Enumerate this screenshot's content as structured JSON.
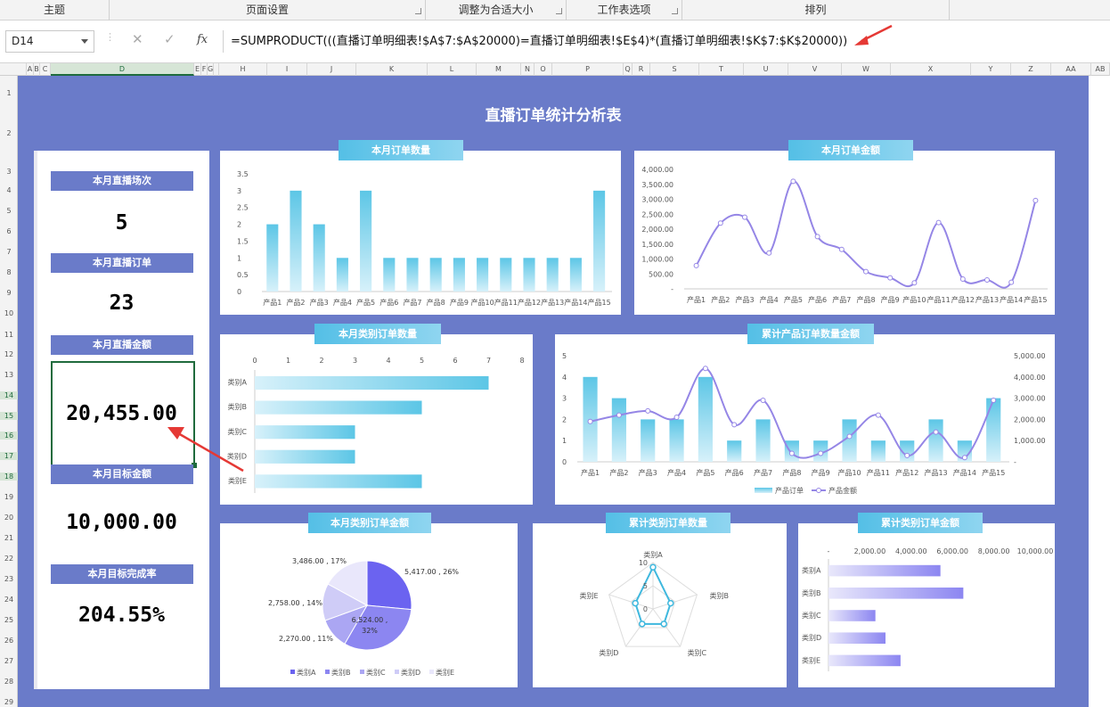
{
  "ribbon": {
    "groups": [
      {
        "label": "主题"
      },
      {
        "label": "页面设置"
      },
      {
        "label": "调整为合适大小"
      },
      {
        "label": "工作表选项"
      },
      {
        "label": "排列"
      }
    ]
  },
  "formula_bar": {
    "name_box": "D14",
    "cancel": "✕",
    "enter": "✓",
    "fx": "fx",
    "formula": "=SUMPRODUCT(((直播订单明细表!$A$7:$A$20000)=直播订单明细表!$E$4)*(直播订单明细表!$K$7:$K$20000))"
  },
  "columns": [
    "A",
    "B",
    "C",
    "D",
    "E",
    "F",
    "G",
    "H",
    "I",
    "J",
    "K",
    "L",
    "M",
    "N",
    "O",
    "P",
    "Q",
    "R",
    "S",
    "T",
    "U",
    "V",
    "W",
    "X",
    "Y",
    "Z",
    "AA",
    "AB",
    "A"
  ],
  "rows": [
    "1",
    "2",
    "3",
    "4",
    "5",
    "6",
    "7",
    "8",
    "9",
    "10",
    "11",
    "12",
    "13",
    "14",
    "15",
    "16",
    "17",
    "18",
    "19",
    "20",
    "21",
    "22",
    "23",
    "24",
    "25",
    "26",
    "27",
    "28",
    "29"
  ],
  "dashboard": {
    "title": "直播订单统计分析表",
    "kpis": [
      {
        "label": "本月直播场次",
        "value": "5"
      },
      {
        "label": "本月直播订单",
        "value": "23"
      },
      {
        "label": "本月直播金额",
        "value": "20,455.00"
      },
      {
        "label": "本月目标金额",
        "value": "10,000.00"
      },
      {
        "label": "本月目标完成率",
        "value": "204.55%"
      }
    ]
  },
  "colors": {
    "dashboard_bg": "#6a7bc9",
    "bar": "#5cc6e6",
    "line": "#9586e6",
    "pie": [
      "#6b63f0",
      "#8c86f1",
      "#aba6f3",
      "#cfccf7",
      "#e9e7fb"
    ]
  },
  "chart_data": [
    {
      "type": "bar",
      "title": "本月订单数量",
      "categories": [
        "产品1",
        "产品2",
        "产品3",
        "产品4",
        "产品5",
        "产品6",
        "产品7",
        "产品8",
        "产品9",
        "产品10",
        "产品11",
        "产品12",
        "产品13",
        "产品14",
        "产品15"
      ],
      "values": [
        2,
        3,
        2,
        1,
        3,
        1,
        1,
        1,
        1,
        1,
        1,
        1,
        1,
        1,
        3
      ],
      "ylim": [
        0,
        3.5
      ],
      "yticks": [
        "0",
        "0.5",
        "1",
        "1.5",
        "2",
        "2.5",
        "3",
        "3.5"
      ]
    },
    {
      "type": "line",
      "title": "本月订单金额",
      "categories": [
        "产品1",
        "产品2",
        "产品3",
        "产品4",
        "产品5",
        "产品6",
        "产品7",
        "产品8",
        "产品9",
        "产品10",
        "产品11",
        "产品12",
        "产品13",
        "产品14",
        "产品15"
      ],
      "values": [
        780,
        2200,
        2400,
        1200,
        3600,
        1750,
        1320,
        580,
        370,
        200,
        2220,
        330,
        300,
        220,
        2960
      ],
      "ylim": [
        0,
        4000
      ],
      "yticks": [
        "-",
        "500.00",
        "1,000.00",
        "1,500.00",
        "2,000.00",
        "2,500.00",
        "3,000.00",
        "3,500.00",
        "4,000.00"
      ]
    },
    {
      "type": "bar",
      "title": "本月类别订单数量",
      "orientation": "horizontal",
      "categories": [
        "类别A",
        "类别B",
        "类别C",
        "类别D",
        "类别E"
      ],
      "values": [
        7,
        5,
        3,
        3,
        5
      ],
      "xlim": [
        0,
        8
      ],
      "xticks": [
        "0",
        "1",
        "2",
        "3",
        "4",
        "5",
        "6",
        "7",
        "8"
      ]
    },
    {
      "type": "bar",
      "title": "累计产品订单数量金额",
      "categories": [
        "产品1",
        "产品2",
        "产品3",
        "产品4",
        "产品5",
        "产品6",
        "产品7",
        "产品8",
        "产品9",
        "产品10",
        "产品11",
        "产品12",
        "产品13",
        "产品14",
        "产品15"
      ],
      "series": [
        {
          "name": "产品订单",
          "type": "bar",
          "values": [
            4,
            3,
            2,
            2,
            4,
            1,
            2,
            1,
            1,
            2,
            1,
            1,
            2,
            1,
            3
          ]
        },
        {
          "name": "产品金额",
          "type": "line",
          "values": [
            1900,
            2200,
            2400,
            2100,
            4400,
            1750,
            2900,
            400,
            400,
            1200,
            2200,
            300,
            1400,
            200,
            2900
          ]
        }
      ],
      "ylim": [
        0,
        5
      ],
      "yticks": [
        "0",
        "1",
        "2",
        "3",
        "4",
        "5"
      ],
      "y2lim": [
        0,
        5000
      ],
      "y2ticks": [
        "-",
        "1,000.00",
        "2,000.00",
        "3,000.00",
        "4,000.00",
        "5,000.00"
      ],
      "legend": "bottom"
    },
    {
      "type": "pie",
      "title": "本月类别订单金额",
      "categories": [
        "类别A",
        "类别B",
        "类别C",
        "类别D",
        "类别E"
      ],
      "values": [
        5417,
        6524,
        2270,
        2758,
        3486
      ],
      "labels": [
        "5,417.00 , 26%",
        "6,524.00 , 32%",
        "2,270.00 , 11%",
        "2,758.00 , 14%",
        "3,486.00 , 17%"
      ],
      "legend": "bottom"
    },
    {
      "type": "radar",
      "title": "累计类别订单数量",
      "categories": [
        "类别A",
        "类别B",
        "类别C",
        "类别D",
        "类别E"
      ],
      "values": [
        9,
        4,
        4,
        4,
        4
      ],
      "rlim": [
        0,
        10
      ],
      "rticks": [
        "0",
        "5",
        "10"
      ]
    },
    {
      "type": "bar",
      "title": "累计类别订单金额",
      "orientation": "horizontal",
      "categories": [
        "类别A",
        "类别B",
        "类别C",
        "类别D",
        "类别E"
      ],
      "values": [
        5417,
        6524,
        2270,
        2758,
        3486
      ],
      "xlim": [
        0,
        10000
      ],
      "xticks": [
        "-",
        "2,000.00",
        "4,000.00",
        "6,000.00",
        "8,000.00",
        "10,000.00"
      ]
    }
  ]
}
